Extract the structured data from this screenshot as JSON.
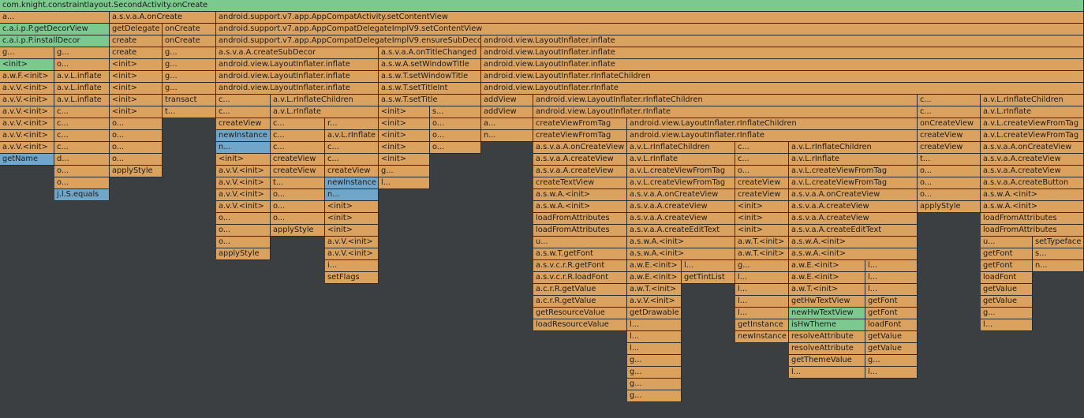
{
  "colors": {
    "background": "#3c3f41",
    "app": "#daa15f",
    "framework": "#7bc98e",
    "highlight": "#6fa6c9"
  },
  "rows": [
    [
      [
        "com.knight.constraintlayout.SecondActivity.onCreate",
        "g"
      ]
    ],
    [
      [
        "a...",
        "o"
      ],
      [
        "a.s.v.a.A.onCreate",
        "o"
      ],
      [
        "android.support.v7.app.AppCompatActivity.setContentView",
        "o"
      ]
    ],
    [
      [
        "c.a.i.p.P.getDecorView",
        "g"
      ],
      [
        "getDelegate",
        "o"
      ],
      [
        "onCreate",
        "o"
      ],
      [
        "android.support.v7.app.AppCompatDelegateImplV9.setContentView",
        "o"
      ]
    ],
    [
      [
        "c.a.i.p.P.installDecor",
        "g"
      ],
      [
        "create",
        "o"
      ],
      [
        "onCreate",
        "o"
      ],
      [
        "android.support.v7.app.AppCompatDelegateImplV9.ensureSubDecor",
        "o"
      ],
      [
        "android.view.LayoutInflater.inflate",
        "o"
      ]
    ],
    [
      [
        "g...",
        "o"
      ],
      [
        "g...",
        "o"
      ],
      [
        "create",
        "o"
      ],
      [
        "g...",
        "o"
      ],
      [
        "a.s.v.a.A.createSubDecor",
        "o"
      ],
      [
        "a.s.v.a.A.onTitleChanged",
        "o"
      ],
      [
        "android.view.LayoutInflater.inflate",
        "o"
      ]
    ],
    [
      [
        "<init>",
        "g"
      ],
      [
        "o...",
        "o"
      ],
      [
        "<init>",
        "o"
      ],
      [
        "g...",
        "o"
      ],
      [
        "android.view.LayoutInflater.inflate",
        "o"
      ],
      [
        "a.s.w.A.setWindowTitle",
        "o"
      ],
      [
        "android.view.LayoutInflater.inflate",
        "o"
      ]
    ],
    [
      [
        "a.w.F.<init>",
        "o"
      ],
      [
        "a.v.L.inflate",
        "o"
      ],
      [
        "<init>",
        "o"
      ],
      [
        "g...",
        "o"
      ],
      [
        "android.view.LayoutInflater.inflate",
        "o"
      ],
      [
        "a.s.w.T.setWindowTitle",
        "o"
      ],
      [
        "android.view.LayoutInflater.rInflateChildren",
        "o"
      ]
    ],
    [
      [
        "a.v.V.<init>",
        "o"
      ],
      [
        "a.v.L.inflate",
        "o"
      ],
      [
        "<init>",
        "o"
      ],
      [
        "g...",
        "o"
      ],
      [
        "android.view.LayoutInflater.inflate",
        "o"
      ],
      [
        "a.s.w.T.setTitleInt",
        "o"
      ],
      [
        "android.view.LayoutInflater.rInflate",
        "o"
      ]
    ],
    [
      [
        "a.v.V.<init>",
        "o"
      ],
      [
        "a.v.L.inflate",
        "o"
      ],
      [
        "<init>",
        "o"
      ],
      [
        "transact",
        "o"
      ],
      [
        "c...",
        "o"
      ],
      [
        "a.v.L.rInflateChildren",
        "o"
      ],
      [
        "a.s.w.T.setTitle",
        "o"
      ],
      [
        "addView",
        "o"
      ],
      [
        "android.view.LayoutInflater.rInflateChildren",
        "o"
      ],
      [
        "c...",
        "o"
      ],
      [
        "a.v.L.rInflateChildren",
        "o"
      ]
    ],
    [
      [
        "a.v.V.<init>",
        "o"
      ],
      [
        "c...",
        "o"
      ],
      [
        "<init>",
        "o"
      ],
      [
        "t...",
        "o"
      ],
      [
        "c...",
        "o"
      ],
      [
        "a.v.L.rInflate",
        "o"
      ],
      [
        "<init>",
        "o"
      ],
      [
        "s...",
        "o"
      ],
      [
        "addView",
        "o"
      ],
      [
        "android.view.LayoutInflater.rInflate",
        "o"
      ],
      [
        "c...",
        "o"
      ],
      [
        "a.v.L.rInflate",
        "o"
      ]
    ],
    [
      [
        "a.v.V.<init>",
        "o"
      ],
      [
        "c...",
        "o"
      ],
      [
        "o...",
        "o"
      ],
      [
        "createView",
        "o"
      ],
      [
        "c...",
        "o"
      ],
      [
        "r...",
        "o"
      ],
      [
        "<init>",
        "o"
      ],
      [
        "o...",
        "o"
      ],
      [
        "a...",
        "o"
      ],
      [
        "createViewFromTag",
        "o"
      ],
      [
        "android.view.LayoutInflater.rInflateChildren",
        "o"
      ],
      [
        "onCreateView",
        "o"
      ],
      [
        "a.v.L.createViewFromTag",
        "o"
      ]
    ],
    [
      [
        "a.v.V.<init>",
        "o"
      ],
      [
        "c...",
        "o"
      ],
      [
        "o...",
        "o"
      ],
      [
        "newInstance",
        "b"
      ],
      [
        "c...",
        "o"
      ],
      [
        "a.v.L.rInflate",
        "o"
      ],
      [
        "<init>",
        "o"
      ],
      [
        "o...",
        "o"
      ],
      [
        "n...",
        "o"
      ],
      [
        "createViewFromTag",
        "o"
      ],
      [
        "android.view.LayoutInflater.rInflate",
        "o"
      ],
      [
        "createView",
        "o"
      ],
      [
        "a.v.L.createViewFromTag",
        "o"
      ]
    ],
    [
      [
        "a.v.V.<init>",
        "o"
      ],
      [
        "c...",
        "o"
      ],
      [
        "o...",
        "o"
      ],
      [
        "n...",
        "b"
      ],
      [
        "c...",
        "o"
      ],
      [
        "c...",
        "o"
      ],
      [
        "<init>",
        "o"
      ],
      [
        "o...",
        "o"
      ],
      [
        "a.s.v.a.A.onCreateView",
        "o"
      ],
      [
        "a.v.L.rInflateChildren",
        "o"
      ],
      [
        "c...",
        "o"
      ],
      [
        "a.v.L.rInflateChildren",
        "o"
      ],
      [
        "createView",
        "o"
      ],
      [
        "a.s.v.a.A.onCreateView",
        "o"
      ]
    ],
    [
      [
        "getName",
        "b"
      ],
      [
        "d...",
        "o"
      ],
      [
        "o...",
        "o"
      ],
      [
        "<init>",
        "o"
      ],
      [
        "createView",
        "o"
      ],
      [
        "c...",
        "o"
      ],
      [
        "<init>",
        "o"
      ],
      [
        "a.s.v.a.A.createView",
        "o"
      ],
      [
        "a.v.L.rInflate",
        "o"
      ],
      [
        "c...",
        "o"
      ],
      [
        "a.v.L.rInflate",
        "o"
      ],
      [
        "t...",
        "o"
      ],
      [
        "a.s.v.a.A.createView",
        "o"
      ]
    ],
    [
      [
        "o...",
        "o"
      ],
      [
        "applyStyle",
        "o"
      ],
      [
        "a.v.V.<init>",
        "o"
      ],
      [
        "createView",
        "o"
      ],
      [
        "createView",
        "o"
      ],
      [
        "g...",
        "o"
      ],
      [
        "a.s.v.a.A.createView",
        "o"
      ],
      [
        "a.v.L.createViewFromTag",
        "o"
      ],
      [
        "o...",
        "o"
      ],
      [
        "a.v.L.createViewFromTag",
        "o"
      ],
      [
        "o...",
        "o"
      ],
      [
        "a.s.v.a.A.createView",
        "o"
      ]
    ],
    [
      [
        "o...",
        "o"
      ],
      [
        "a.v.V.<init>",
        "o"
      ],
      [
        "t...",
        "o"
      ],
      [
        "newInstance",
        "b"
      ],
      [
        "l...",
        "o"
      ],
      [
        "createTextView",
        "o"
      ],
      [
        "a.v.L.createViewFromTag",
        "o"
      ],
      [
        "createView",
        "o"
      ],
      [
        "a.v.L.createViewFromTag",
        "o"
      ],
      [
        "o...",
        "o"
      ],
      [
        "a.s.v.a.A.createButton",
        "o"
      ]
    ],
    [
      [
        "j.l.S.equals",
        "b"
      ],
      [
        "a.v.V.<init>",
        "o"
      ],
      [
        "o...",
        "o"
      ],
      [
        "n...",
        "b"
      ],
      [
        "a.s.w.A.<init>",
        "o"
      ],
      [
        "a.s.v.a.A.onCreateView",
        "o"
      ],
      [
        "createView",
        "o"
      ],
      [
        "a.s.v.a.A.onCreateView",
        "o"
      ],
      [
        "o...",
        "o"
      ],
      [
        "a.s.w.A.<init>",
        "o"
      ]
    ],
    [
      [
        "a.v.V.<init>",
        "o"
      ],
      [
        "o...",
        "o"
      ],
      [
        "<init>",
        "o"
      ],
      [
        "a.s.w.A.<init>",
        "o"
      ],
      [
        "a.s.v.a.A.createView",
        "o"
      ],
      [
        "<init>",
        "o"
      ],
      [
        "a.s.v.a.A.createView",
        "o"
      ],
      [
        "applyStyle",
        "o"
      ],
      [
        "a.s.w.A.<init>",
        "o"
      ]
    ],
    [
      [
        "o...",
        "o"
      ],
      [
        "o...",
        "o"
      ],
      [
        "<init>",
        "o"
      ],
      [
        "loadFromAttributes",
        "o"
      ],
      [
        "a.s.v.a.A.createView",
        "o"
      ],
      [
        "<init>",
        "o"
      ],
      [
        "a.s.v.a.A.createView",
        "o"
      ],
      [
        "loadFromAttributes",
        "o"
      ]
    ],
    [
      [
        "o...",
        "o"
      ],
      [
        "applyStyle",
        "o"
      ],
      [
        "<init>",
        "o"
      ],
      [
        "loadFromAttributes",
        "o"
      ],
      [
        "a.s.v.a.A.createEditText",
        "o"
      ],
      [
        "<init>",
        "o"
      ],
      [
        "a.s.v.a.A.createEditText",
        "o"
      ],
      [
        "loadFromAttributes",
        "o"
      ]
    ],
    [
      [
        "o...",
        "o"
      ],
      [
        "a.v.V.<init>",
        "o"
      ],
      [
        "u...",
        "o"
      ],
      [
        "a.s.w.A.<init>",
        "o"
      ],
      [
        "a.w.T.<init>",
        "o"
      ],
      [
        "a.s.w.A.<init>",
        "o"
      ],
      [
        "u...",
        "o"
      ],
      [
        "setTypeface",
        "o"
      ]
    ],
    [
      [
        "applyStyle",
        "o"
      ],
      [
        "a.v.V.<init>",
        "o"
      ],
      [
        "a.s.w.T.getFont",
        "o"
      ],
      [
        "a.s.w.A.<init>",
        "o"
      ],
      [
        "a.w.T.<init>",
        "o"
      ],
      [
        "a.s.w.A.<init>",
        "o"
      ],
      [
        "getFont",
        "o"
      ],
      [
        "s...",
        "o"
      ]
    ],
    [
      [
        "i...",
        "o"
      ],
      [
        "a.s.v.c.r.R.getFont",
        "o"
      ],
      [
        "a.w.E.<init>",
        "o"
      ],
      [
        "l...",
        "o"
      ],
      [
        "g...",
        "o"
      ],
      [
        "a.w.E.<init>",
        "o"
      ],
      [
        "l...",
        "o"
      ],
      [
        "getFont",
        "o"
      ],
      [
        "n...",
        "o"
      ]
    ],
    [
      [
        "setFlags",
        "o"
      ],
      [
        "a.s.v.c.r.R.loadFont",
        "o"
      ],
      [
        "a.w.E.<init>",
        "o"
      ],
      [
        "getTintList",
        "o"
      ],
      [
        "l...",
        "o"
      ],
      [
        "a.w.E.<init>",
        "o"
      ],
      [
        "l...",
        "o"
      ],
      [
        "loadFont",
        "o"
      ]
    ],
    [
      [
        "a.c.r.R.getValue",
        "o"
      ],
      [
        "a.w.T.<init>",
        "o"
      ],
      [
        "l...",
        "o"
      ],
      [
        "a.w.T.<init>",
        "o"
      ],
      [
        "l...",
        "o"
      ],
      [
        "getValue",
        "o"
      ]
    ],
    [
      [
        "a.c.r.R.getValue",
        "o"
      ],
      [
        "a.v.V.<init>",
        "o"
      ],
      [
        "l...",
        "o"
      ],
      [
        "getHwTextView",
        "o"
      ],
      [
        "getFont",
        "o"
      ],
      [
        "getValue",
        "o"
      ]
    ],
    [
      [
        "getResourceValue",
        "o"
      ],
      [
        "getDrawable",
        "o"
      ],
      [
        "l...",
        "o"
      ],
      [
        "newHwTextView",
        "g"
      ],
      [
        "getFont",
        "o"
      ],
      [
        "g...",
        "o"
      ]
    ],
    [
      [
        "loadResourceValue",
        "o"
      ],
      [
        "l...",
        "o"
      ],
      [
        "getInstance",
        "o"
      ],
      [
        "isHwTheme",
        "g"
      ],
      [
        "loadFont",
        "o"
      ],
      [
        "l...",
        "o"
      ]
    ],
    [
      [
        "l...",
        "o"
      ],
      [
        "newInstance",
        "o"
      ],
      [
        "resolveAttribute",
        "o"
      ],
      [
        "getValue",
        "o"
      ]
    ],
    [
      [
        "l...",
        "o"
      ],
      [
        "resolveAttribute",
        "o"
      ],
      [
        "getValue",
        "o"
      ]
    ],
    [
      [
        "g...",
        "o"
      ],
      [
        "getThemeValue",
        "o"
      ],
      [
        "g...",
        "o"
      ]
    ],
    [
      [
        "g...",
        "o"
      ],
      [
        "l...",
        "o"
      ],
      [
        "l...",
        "o"
      ]
    ],
    [
      [
        "g...",
        "o"
      ]
    ],
    [
      [
        "g...",
        "o"
      ]
    ]
  ]
}
